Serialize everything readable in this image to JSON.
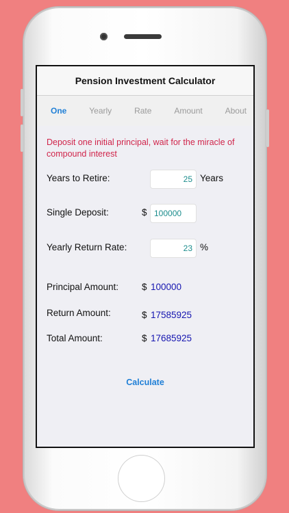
{
  "app": {
    "title": "Pension Investment Calculator"
  },
  "tabs": [
    {
      "label": "One"
    },
    {
      "label": "Yearly"
    },
    {
      "label": "Rate"
    },
    {
      "label": "Amount"
    },
    {
      "label": "About"
    }
  ],
  "intro": "Deposit one initial principal, wait for the miracle of compound interest",
  "form": {
    "years_label": "Years to Retire:",
    "years_value": "25",
    "years_unit": "Years",
    "deposit_label": "Single Deposit:",
    "deposit_currency": "$",
    "deposit_value": "100000",
    "rate_label": "Yearly Return Rate:",
    "rate_value": "23",
    "rate_unit": "%"
  },
  "results": {
    "principal_label": "Principal Amount:",
    "principal_currency": "$",
    "principal_value": "100000",
    "return_label": "Return Amount:",
    "return_currency": "$",
    "return_value": "17585925",
    "total_label": "Total Amount:",
    "total_currency": "$",
    "total_value": "17685925"
  },
  "actions": {
    "calculate_label": "Calculate"
  },
  "colors": {
    "background": "#f08080",
    "accent": "#1f7fd6",
    "intro_text": "#d0244a",
    "result_text": "#1515b0",
    "field_text": "#1a8c8c"
  }
}
